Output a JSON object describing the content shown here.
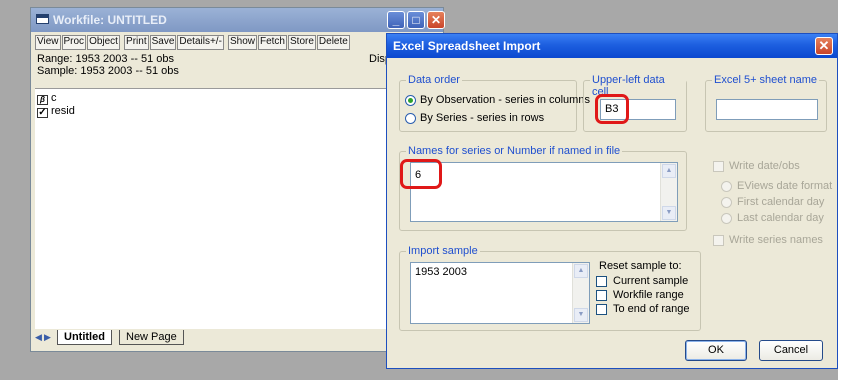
{
  "workfile": {
    "title": "Workfile: UNTITLED",
    "toolbar": [
      "View",
      "Proc",
      "Object",
      "Print",
      "Save",
      "Details+/-",
      "Show",
      "Fetch",
      "Store",
      "Delete"
    ],
    "range": "Range:  1953 2003  --  51 obs",
    "sample": "Sample: 1953 2003  --  51 obs",
    "display_partial": "Disp",
    "objects": [
      {
        "icon": "coefficient-icon",
        "glyph": "β",
        "name": "c"
      },
      {
        "icon": "residual-series-icon",
        "glyph": "✓",
        "name": "resid"
      }
    ],
    "tabs": [
      "Untitled",
      "New Page"
    ]
  },
  "dialog": {
    "title": "Excel Spreadsheet Import",
    "data_order": {
      "legend": "Data order",
      "options": [
        "By Observation - series in columns",
        "By Series - series in rows"
      ],
      "selected": 0
    },
    "upper_left": {
      "legend": "Upper-left data cell",
      "value": "B3"
    },
    "sheet_name": {
      "legend": "Excel 5+ sheet name",
      "value": ""
    },
    "names": {
      "legend": "Names for series or Number if named in file",
      "value": "6"
    },
    "write_date": {
      "label": "Write date/obs",
      "options": [
        "EViews date format",
        "First calendar day",
        "Last calendar day"
      ]
    },
    "write_series_names": "Write series names",
    "import_sample": {
      "legend": "Import sample",
      "value": "1953 2003",
      "reset_label": "Reset sample to:",
      "reset_options": [
        "Current sample",
        "Workfile range",
        "To end of range"
      ]
    },
    "ok": "OK",
    "cancel": "Cancel"
  },
  "colors": {
    "dialog_title": "#0b48cf",
    "highlight": "#e01818",
    "legend_text": "#1f4fcf"
  }
}
